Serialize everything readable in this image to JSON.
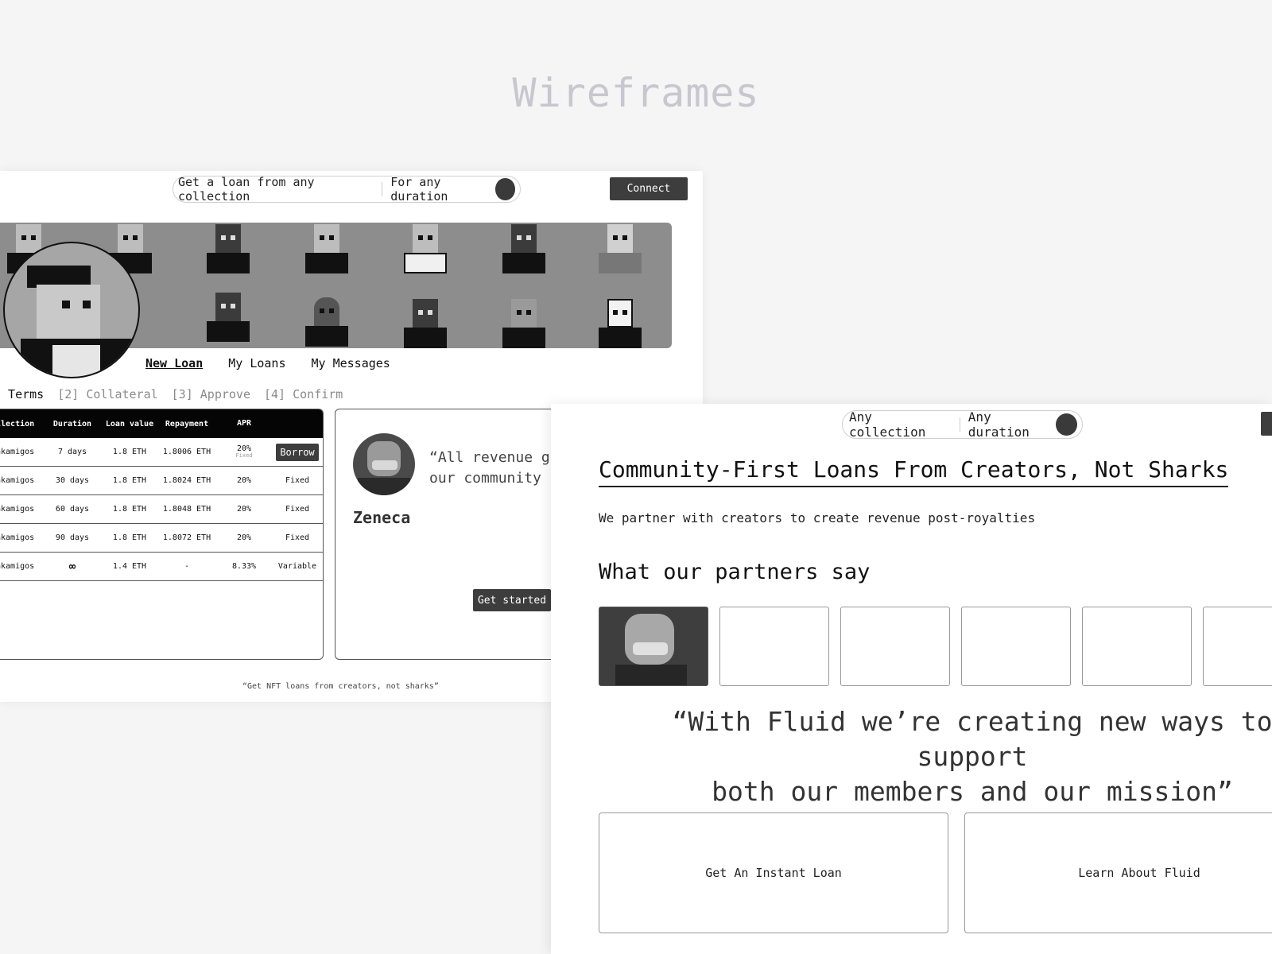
{
  "heading": "Wireframes",
  "loan_page": {
    "search_pill": {
      "collection": "Get a loan from any collection",
      "duration": "For any duration"
    },
    "connect_label": "Connect",
    "tabs": [
      "New Loan",
      "My Loans",
      "My Messages"
    ],
    "steps": [
      "] Terms",
      "[2] Collateral",
      "[3] Approve",
      "[4] Confirm"
    ],
    "table": {
      "headers": [
        "llection",
        "Duration",
        "Loan value",
        "Repayment",
        "APR",
        ""
      ],
      "rows": [
        {
          "collection": "akamigos",
          "duration": "7 days",
          "loan_value": "1.8 ETH",
          "repayment": "1.8006 ETH",
          "apr": "20%",
          "apr_sub": "Fixed",
          "action": "Borrow"
        },
        {
          "collection": "akamigos",
          "duration": "30 days",
          "loan_value": "1.8 ETH",
          "repayment": "1.8024 ETH",
          "apr": "20%",
          "action": "Fixed"
        },
        {
          "collection": "akamigos",
          "duration": "60 days",
          "loan_value": "1.8 ETH",
          "repayment": "1.8048 ETH",
          "apr": "20%",
          "action": "Fixed"
        },
        {
          "collection": "akamigos",
          "duration": "90 days",
          "loan_value": "1.8 ETH",
          "repayment": "1.8072 ETH",
          "apr": "20%",
          "action": "Fixed"
        },
        {
          "collection": "akamigos",
          "duration": "∞",
          "loan_value": "1.4 ETH",
          "repayment": "-",
          "apr": "8.33%",
          "action": "Variable"
        }
      ]
    },
    "quote": {
      "line1": "“All revenue go",
      "line2": "our community a",
      "name": "Zeneca"
    },
    "get_started_label": "Get started",
    "tagline": "“Get NFT loans from creators, not sharks”"
  },
  "landing_page": {
    "search_pill": {
      "collection": "Any collection",
      "duration": "Any duration"
    },
    "title": "Community-First Loans From Creators, Not Sharks",
    "subtitle": "We partner with creators to create revenue post-royalties",
    "partners_heading": "What our partners say",
    "quote_line1": "“With Fluid we’re creating new ways to support",
    "quote_line2": "both our members and our mission”",
    "cta_loan": "Get An Instant Loan",
    "cta_learn": "Learn About Fluid"
  },
  "colors": {
    "heading": "#c8c7cf",
    "dark_button": "#3d3d3d",
    "banner": "#8d8d8d",
    "table_header": "#050505"
  }
}
